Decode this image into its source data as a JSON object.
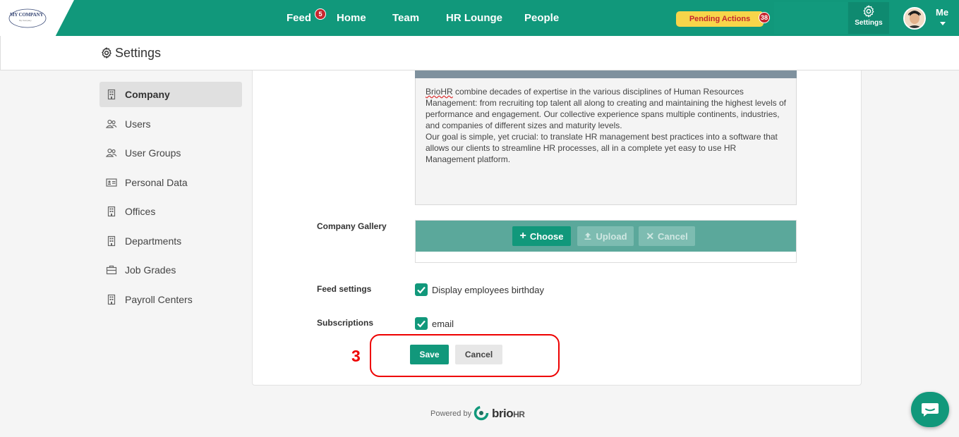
{
  "topbar": {
    "logo": {
      "text": "MY COMPANY",
      "sub": "My Company"
    },
    "nav": [
      {
        "label": "Feed",
        "badge": "5"
      },
      {
        "label": "Home"
      },
      {
        "label": "Team"
      },
      {
        "label": "HR Lounge"
      },
      {
        "label": "People"
      }
    ],
    "pending": {
      "label": "Pending Actions",
      "badge": "38"
    },
    "settings_label": "Settings",
    "user_label": "Me"
  },
  "header": {
    "title": "Settings"
  },
  "sidebar": {
    "items": [
      {
        "label": "Company",
        "icon": "building-icon",
        "active": true
      },
      {
        "label": "Users",
        "icon": "users-icon"
      },
      {
        "label": "User Groups",
        "icon": "user-groups-icon"
      },
      {
        "label": "Personal Data",
        "icon": "id-card-icon"
      },
      {
        "label": "Offices",
        "icon": "building-icon"
      },
      {
        "label": "Departments",
        "icon": "building-icon"
      },
      {
        "label": "Job Grades",
        "icon": "briefcase-icon"
      },
      {
        "label": "Payroll Centers",
        "icon": "building-icon"
      }
    ]
  },
  "form": {
    "description": {
      "word": "BrioHR",
      "line1": " combine decades of expertise in the various disciplines of Human Resources Management: from recruiting top talent all along to creating and maintaining the highest levels of performance and engagement. Our collective experience spans multiple continents, industries, and companies of different sizes and maturity levels.",
      "line2": "Our goal is simple, yet crucial: to translate HR management best practices into a software that allows our clients to streamline HR processes, all in a complete yet easy to use HR Management platform."
    },
    "gallery": {
      "label": "Company Gallery",
      "choose": "Choose",
      "upload": "Upload",
      "cancel": "Cancel"
    },
    "feed": {
      "label": "Feed settings",
      "option": "Display employees birthday",
      "checked": true
    },
    "subscriptions": {
      "label": "Subscriptions",
      "option": "email",
      "checked": true
    },
    "save": "Save",
    "cancel": "Cancel"
  },
  "annotation": {
    "step": "3"
  },
  "footer": {
    "powered": "Powered by",
    "brand": "brio",
    "brand_suffix": "HR"
  },
  "colors": {
    "primary": "#11987b",
    "badge": "#c6262e",
    "pending": "#f7d54a",
    "highlight": "#e00000"
  }
}
